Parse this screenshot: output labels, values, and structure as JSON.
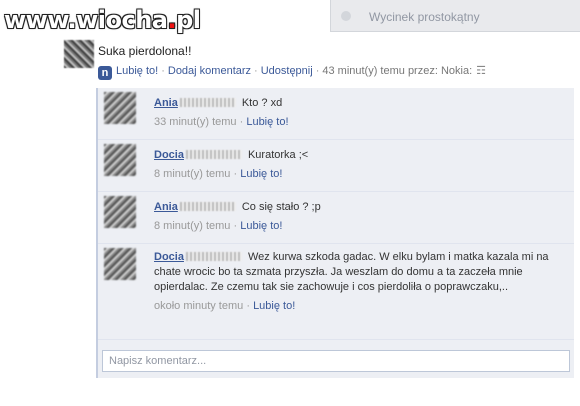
{
  "watermark": {
    "text_left": "www.wiocha",
    "text_dot": ".",
    "text_right": "pl"
  },
  "topbar": {
    "placeholder": "Wycinek prostokątny"
  },
  "post": {
    "text": "Suka pierdolona!!",
    "actions": {
      "like": "Lubię to!",
      "comment": "Dodaj komentarz",
      "share": "Udostępnij",
      "meta": "43 minut(y) temu przez: Nokia:",
      "sep": "·"
    }
  },
  "comments": [
    {
      "author": "Ania",
      "text": "Kto ? xd",
      "time": "33 minut(y) temu",
      "like": "Lubię to!"
    },
    {
      "author": "Docia",
      "text": "Kuratorka ;<",
      "time": "8 minut(y) temu",
      "like": "Lubię to!"
    },
    {
      "author": "Ania",
      "text": "Co się stało ? ;p",
      "time": "8 minut(y) temu",
      "like": "Lubię to!"
    },
    {
      "author": "Docia",
      "text": "Wez kurwa szkoda gadac. W elku bylam i matka kazala mi na chate wrocic bo ta szmata przyszła. Ja weszlam do domu a ta zaczeła mnie opierdalac. Ze czemu tak sie zachowuje i cos pierdoliła o poprawczaku,..",
      "time": "około minuty temu",
      "like": "Lubię to!"
    }
  ],
  "composer": {
    "placeholder": "Napisz komentarz..."
  }
}
